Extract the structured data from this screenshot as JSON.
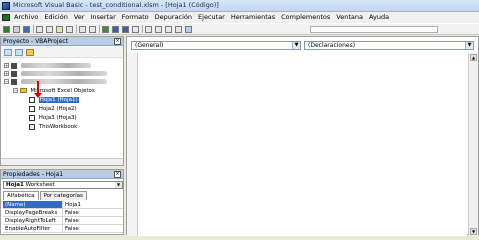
{
  "window": {
    "title": "Microsoft Visual Basic - test_conditional.xlsm - [Hoja1 (Código)]"
  },
  "menu": [
    {
      "label": "Archivo"
    },
    {
      "label": "Edición"
    },
    {
      "label": "Ver"
    },
    {
      "label": "Insertar"
    },
    {
      "label": "Formato"
    },
    {
      "label": "Depuración"
    },
    {
      "label": "Ejecutar"
    },
    {
      "label": "Herramientas"
    },
    {
      "label": "Complementos"
    },
    {
      "label": "Ventana"
    },
    {
      "label": "Ayuda"
    }
  ],
  "project": {
    "title": "Proyecto - VBAProject",
    "tree": {
      "folder_label": "Microsoft Excel Objetos",
      "items": [
        "Hoja1 (Hoja1)",
        "Hoja2 (Hoja2)",
        "Hoja3 (Hoja3)",
        "ThisWorkbook"
      ],
      "selected_index": 0
    }
  },
  "properties": {
    "title": "Propiedades - Hoja1",
    "object_name": "Hoja1",
    "object_type": "Worksheet",
    "tabs": [
      "Alfabética",
      "Por categorías"
    ],
    "rows": [
      {
        "name": "(Name)",
        "value": "Hoja1"
      },
      {
        "name": "DisplayPageBreaks",
        "value": "False"
      },
      {
        "name": "DisplayRightToLeft",
        "value": "False"
      },
      {
        "name": "EnableAutoFilter",
        "value": "False"
      }
    ]
  },
  "code": {
    "object_combo": "(General)",
    "proc_combo": "(Declaraciones)"
  }
}
